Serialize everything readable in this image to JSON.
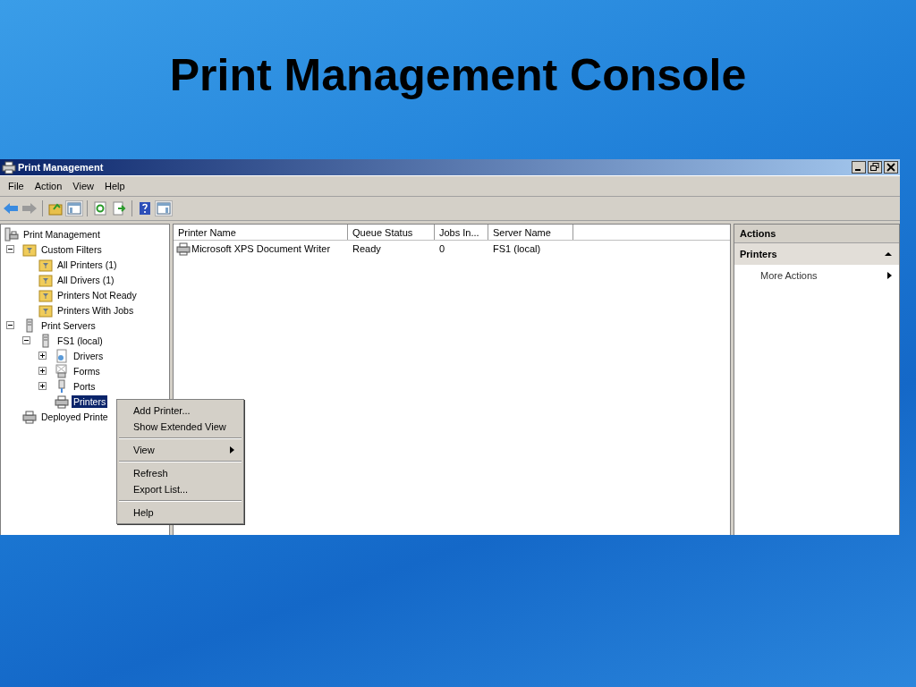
{
  "slide_title": "Print Management Console",
  "window": {
    "title": "Print Management"
  },
  "menu_bar": [
    "File",
    "Action",
    "View",
    "Help"
  ],
  "tree": [
    {
      "label": "Print Management",
      "kind": "console",
      "selected": false,
      "children": [
        {
          "label": "Custom Filters",
          "kind": "filter",
          "selected": false,
          "expanded": true,
          "children": [
            {
              "label": "All Printers (1)",
              "kind": "filter",
              "selected": false
            },
            {
              "label": "All Drivers (1)",
              "kind": "filter",
              "selected": false
            },
            {
              "label": "Printers Not Ready",
              "kind": "filter",
              "selected": false
            },
            {
              "label": "Printers With Jobs",
              "kind": "filter",
              "selected": false
            }
          ]
        },
        {
          "label": "Print Servers",
          "kind": "server",
          "selected": false,
          "expanded": true,
          "children": [
            {
              "label": "FS1 (local)",
              "kind": "server",
              "selected": false,
              "expanded": true,
              "children": [
                {
                  "label": "Drivers",
                  "kind": "drivers",
                  "selected": false,
                  "expanded": false
                },
                {
                  "label": "Forms",
                  "kind": "forms",
                  "selected": false,
                  "expanded": false
                },
                {
                  "label": "Ports",
                  "kind": "ports",
                  "selected": false,
                  "expanded": false
                },
                {
                  "label": "Printers",
                  "kind": "printer",
                  "selected": true
                }
              ]
            }
          ]
        },
        {
          "label": "Deployed Printe",
          "kind": "printer",
          "selected": false
        }
      ]
    }
  ],
  "table": {
    "columns": [
      "Printer Name",
      "Queue Status",
      "Jobs In...",
      "Server Name"
    ],
    "rows": [
      {
        "cells": [
          "Microsoft XPS Document Writer",
          "Ready",
          "0",
          "FS1 (local)"
        ],
        "selected": false
      }
    ]
  },
  "actions": {
    "title": "Actions",
    "section": "Printers",
    "expanded": true,
    "items": [
      {
        "label": "More Actions",
        "has_submenu": true
      }
    ]
  },
  "context_menu": {
    "groups": [
      [
        {
          "label": "Add Printer...",
          "has_submenu": false
        },
        {
          "label": "Show Extended View",
          "has_submenu": false
        }
      ],
      [
        {
          "label": "View",
          "has_submenu": true
        }
      ],
      [
        {
          "label": "Refresh",
          "has_submenu": false
        },
        {
          "label": "Export List...",
          "has_submenu": false
        }
      ],
      [
        {
          "label": "Help",
          "has_submenu": false
        }
      ]
    ]
  }
}
